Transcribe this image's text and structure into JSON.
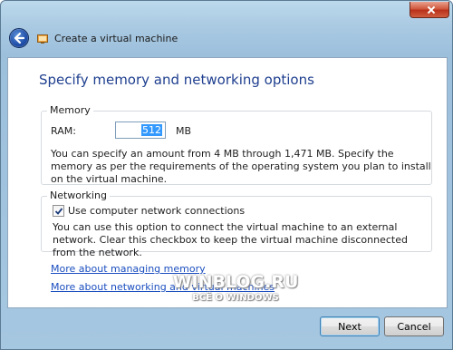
{
  "window": {
    "title": "Create a virtual machine"
  },
  "page": {
    "heading": "Specify memory and networking options"
  },
  "memory": {
    "group_label": "Memory",
    "ram_label": "RAM:",
    "ram_value": "512",
    "unit": "MB",
    "description": "You can specify an amount from 4 MB through 1,471 MB. Specify the memory as per the requirements of the operating system you plan to install on the virtual machine."
  },
  "networking": {
    "group_label": "Networking",
    "checkbox_label": "Use computer network connections",
    "checkbox_checked": true,
    "description": "You can use this option to connect the virtual machine to an external network. Clear this checkbox to keep the virtual machine disconnected from the network."
  },
  "links": {
    "memory": "More about managing memory",
    "networking": "More about networking and virtual machines"
  },
  "watermark": {
    "line1": "WINBLOG.RU",
    "line2": "ВСЁ О WINDOWS"
  },
  "buttons": {
    "next": "Next",
    "cancel": "Cancel"
  },
  "icons": {
    "back": "back-arrow-icon",
    "app": "virtual-machine-icon",
    "close": "close-icon"
  },
  "colors": {
    "heading": "#1f3f8f",
    "link": "#1a4ebf",
    "close_button": "#c73a1f"
  }
}
